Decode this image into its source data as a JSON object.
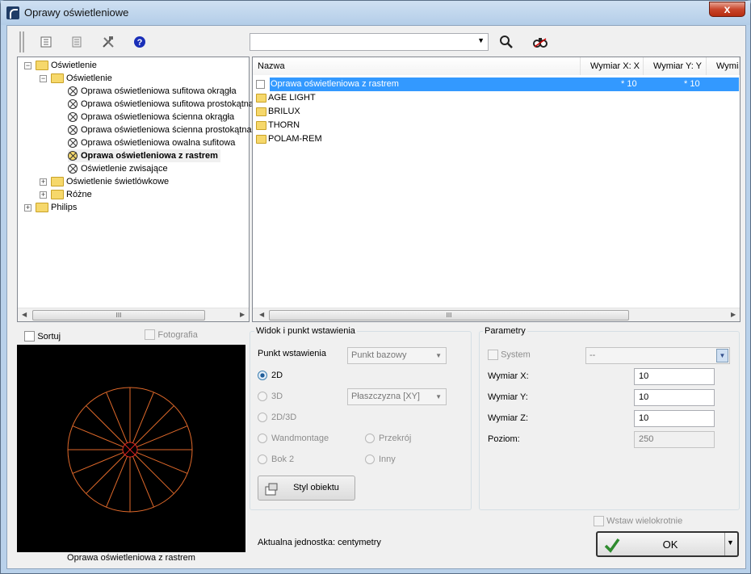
{
  "window": {
    "title": "Oprawy oświetleniowe",
    "close_label": "x"
  },
  "toolbar": {
    "search_value": ""
  },
  "tree": {
    "root": "Oświetlenie",
    "child": "Oświetlenie",
    "items": [
      "Oprawa oświetleniowa sufitowa okrągła",
      "Oprawa oświetleniowa sufitowa prostokątna",
      "Oprawa oświetleniowa ścienna okrągła",
      "Oprawa oświetleniowa ścienna prostokątna",
      "Oprawa oświetleniowa owalna sufitowa",
      "Oprawa oświetleniowa z rastrem",
      "Oświetlenie zwisające"
    ],
    "sibling1": "Oświetlenie świetlówkowe",
    "sibling2": "Różne",
    "root2": "Philips"
  },
  "list": {
    "columns": [
      "Nazwa",
      "Wymiar X: X",
      "Wymiar Y: Y",
      "Wymia"
    ],
    "rows": [
      {
        "name": "Oprawa oświetleniowa z rastrem",
        "x": "* 10",
        "y": "* 10"
      },
      {
        "name": "AGE LIGHT"
      },
      {
        "name": "BRILUX"
      },
      {
        "name": "THORN"
      },
      {
        "name": "POLAM-REM"
      }
    ]
  },
  "preview": {
    "sort_label": "Sortuj",
    "photo_label": "Fotografia",
    "caption": "Oprawa oświetleniowa z rastrem"
  },
  "view": {
    "group_label": "Widok i punkt wstawienia",
    "insert_point_label": "Punkt wstawienia",
    "insert_point_value": "Punkt bazowy",
    "r2d": "2D",
    "r3d": "3D",
    "plane_value": "Płaszczyzna  [XY]",
    "r2d3d": "2D/3D",
    "wand": "Wandmontage",
    "przekroj": "Przekrój",
    "bok2": "Bok 2",
    "inny": "Inny",
    "style_button": "Styl obiektu",
    "unit_text": "Aktualna jednostka: centymetry"
  },
  "params": {
    "group_label": "Parametry",
    "system_label": "System",
    "system_value": "--",
    "x_label": "Wymiar X:",
    "x_value": "10",
    "y_label": "Wymiar Y:",
    "y_value": "10",
    "z_label": "Wymiar Z:",
    "z_value": "10",
    "level_label": "Poziom:",
    "level_value": "250"
  },
  "footer": {
    "multi_label": "Wstaw wielokrotnie",
    "ok_label": "OK"
  }
}
